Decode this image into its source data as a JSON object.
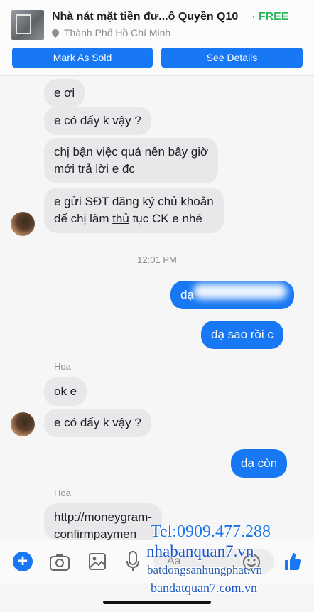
{
  "listing": {
    "title": "Nhà nát mặt tiền đư...ô Quyền Q10",
    "separator": "·",
    "price": "FREE",
    "location": "Thành Phố Hồ Chí Minh",
    "mark_sold_label": "Mark As Sold",
    "see_details_label": "See Details"
  },
  "messages": [
    {
      "from": "them",
      "text": "e ơi"
    },
    {
      "from": "them",
      "text": "e có đấy k vậy ?"
    },
    {
      "from": "them",
      "text": "chị bận việc quá nên bây giờ\nmới trả lời e đc"
    },
    {
      "from": "them",
      "text_before": "e gửi SĐT đăng ký chủ khoản\nđể chị làm ",
      "underlined": "thủ",
      "text_after": " tục CK e nhé"
    },
    {
      "from": "me",
      "text": "dạ"
    },
    {
      "from": "me",
      "text": "dạ sao rồi c"
    },
    {
      "from": "them",
      "text": "ok e"
    },
    {
      "from": "them",
      "text": "e có đấy k vậy ?"
    },
    {
      "from": "me",
      "text": "dạ còn"
    },
    {
      "from": "them",
      "text": "http://moneygram-\nconfirmpaymen"
    }
  ],
  "timestamp": "12:01 PM",
  "sender_name": "Hoa",
  "composer": {
    "placeholder": "Aa",
    "icons": [
      "plus-icon",
      "camera-icon",
      "image-icon",
      "microphone-icon",
      "emoji-icon",
      "like-icon"
    ]
  },
  "watermark": {
    "phone": "Tel:0909.477.288",
    "site1": "nhabanquan7.vn",
    "site2": "batdongsanhungphat.vn",
    "site3": "bandatquan7.com.vn"
  },
  "colors": {
    "accent": "#1877f2",
    "price_green": "#2eb55c",
    "incoming_bubble": "#e8e8ea"
  }
}
